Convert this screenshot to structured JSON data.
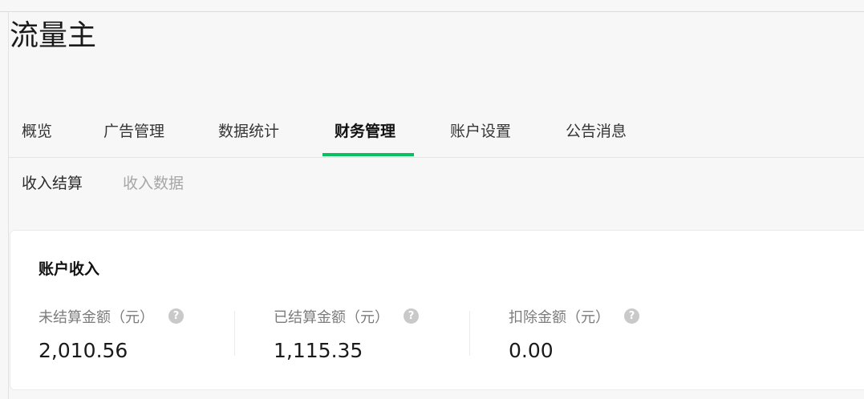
{
  "app": {
    "title": "流量主"
  },
  "main_tabs": [
    {
      "label": "概览"
    },
    {
      "label": "广告管理"
    },
    {
      "label": "数据统计"
    },
    {
      "label": "财务管理"
    },
    {
      "label": "账户设置"
    },
    {
      "label": "公告消息"
    }
  ],
  "active_main_tab": "财务管理",
  "sub_tabs": [
    {
      "label": "收入结算"
    },
    {
      "label": "收入数据"
    }
  ],
  "active_sub_tab": "收入结算",
  "card": {
    "title": "账户收入",
    "stats": [
      {
        "label": "未结算金额（元）",
        "value": "2,010.56"
      },
      {
        "label": "已结算金额（元）",
        "value": "1,115.35"
      },
      {
        "label": "扣除金额（元）",
        "value": "0.00"
      }
    ]
  },
  "colors": {
    "accent": "#07c160",
    "help_icon": "#c9c9c9",
    "inactive_subtab": "#a6a6a6"
  },
  "icons": {
    "help": "question-circle-icon",
    "help_glyph": "?"
  }
}
